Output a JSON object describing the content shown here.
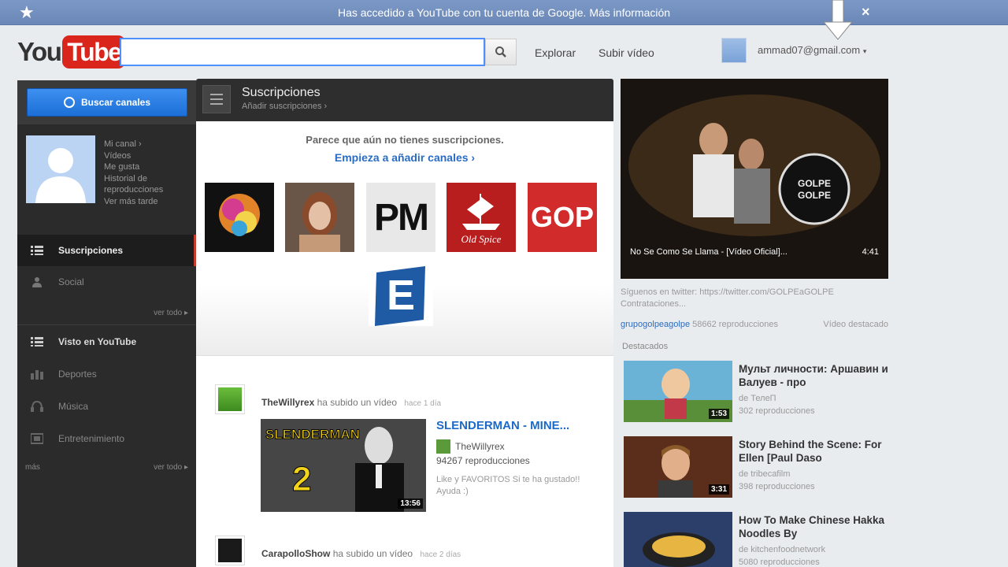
{
  "notification": {
    "message": "Has accedido a YouTube con tu cuenta de Google. Más información",
    "close": "×"
  },
  "header": {
    "logo_you": "You",
    "logo_tube": "Tube",
    "search_value": "",
    "explore": "Explorar",
    "upload": "Subir vídeo",
    "account": "ammad07@gmail.com"
  },
  "guide": {
    "browse_button": "Buscar canales",
    "profile_links": [
      "Mi canal ›",
      "Vídeos",
      "Me gusta",
      "Historial de reproducciones",
      "Ver más tarde"
    ],
    "items": [
      {
        "label": "Suscripciones",
        "icon": "list-icon"
      },
      {
        "label": "Social",
        "icon": "people-icon"
      },
      {
        "label": "Visto en YouTube",
        "icon": "list-icon"
      },
      {
        "label": "Deportes",
        "icon": "bar-chart-icon"
      },
      {
        "label": "Música",
        "icon": "headphones-icon"
      },
      {
        "label": "Entretenimiento",
        "icon": "tv-icon"
      }
    ],
    "see_all_1": "ver todo ▸",
    "see_all_2": "ver todo ▸",
    "section_label": "más"
  },
  "feed": {
    "title": "Suscripciones",
    "subtitle": "Añadir suscripciones ›",
    "empty_message": "Parece que aún no tienes suscripciones.",
    "empty_cta": "Empieza a añadir canales ›",
    "channels": [
      {
        "name": "colorful-channel"
      },
      {
        "name": "portrait-channel"
      },
      {
        "name": "PM",
        "text": "PM"
      },
      {
        "name": "old-spice-channel",
        "text": "Old Spice"
      },
      {
        "name": "gop-channel",
        "text": "GOP"
      },
      {
        "name": "e-channel",
        "text": "E"
      }
    ],
    "activity1": {
      "user": "TheWillyrex",
      "action": "ha subido un vídeo",
      "time": "hace 1 día",
      "video_title": "SLENDERMAN - MINE...",
      "video_channel": "TheWillyrex",
      "video_views": "94267 reproducciones",
      "video_desc": "Like y FAVORITOS Si te ha gustado!! Ayuda :)",
      "duration": "13:56",
      "thumb_text_1": "SLENDERMAN",
      "thumb_text_2": "2"
    },
    "activity2": {
      "user": "CarapolloShow",
      "action": "ha subido un vídeo",
      "time": "hace 2 días"
    }
  },
  "right": {
    "player_title": "No Se Como Se Llama - [Vídeo Oficial]...",
    "player_duration": "4:41",
    "player_badge": "GOLPE GOLPE",
    "description": "Síguenos en twitter: https://twitter.com/GOLPEaGOLPE Contrataciones...",
    "channel": "grupogolpeagolpe",
    "views": "58662 reproducciones",
    "featured_label": "Vídeo destacado",
    "section": "Destacados",
    "recs": [
      {
        "title": "Мульт личности: Аршавин и Валуев - про",
        "by": "de ТелеП",
        "views": "302 reproducciones",
        "duration": "1:53"
      },
      {
        "title": "Story Behind the Scene: For Ellen [Paul Daso",
        "by": "de tribecafilm",
        "views": "398 reproducciones",
        "duration": "3:31"
      },
      {
        "title": "How To Make Chinese Hakka Noodles By",
        "by": "de kitchenfoodnetwork",
        "views": "5080 reproducciones",
        "duration": ""
      }
    ]
  },
  "colors": {
    "notif_bar": "#7390c0",
    "logo_red": "#d9251c",
    "link_blue": "#2a6cc1",
    "guide_bg": "#2b2b2b",
    "accent_red": "#c63b2b"
  }
}
